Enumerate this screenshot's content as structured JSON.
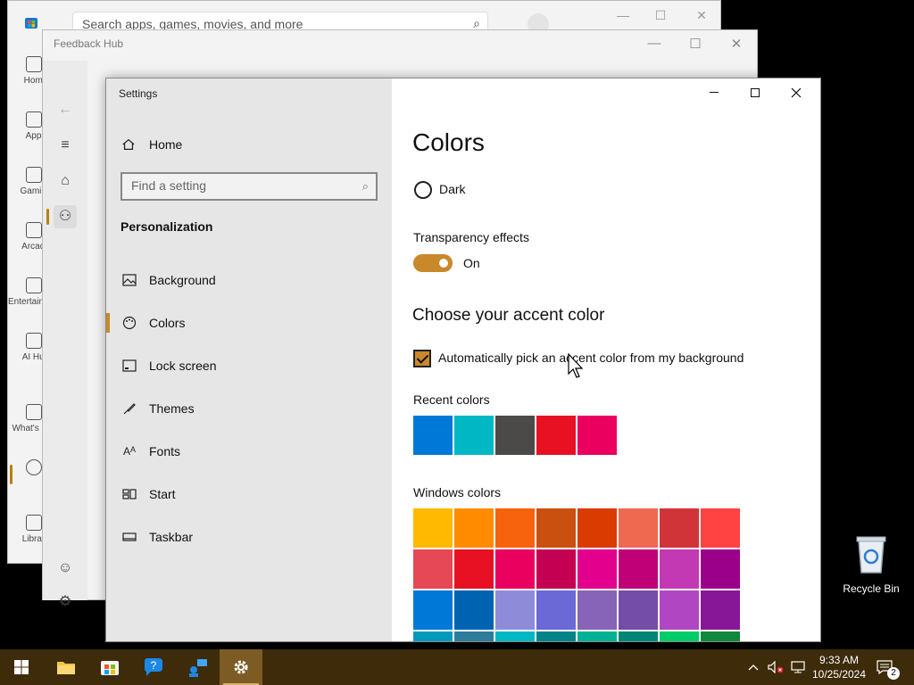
{
  "store": {
    "search_placeholder": "Search apps, games, movies, and more",
    "nav": [
      "Home",
      "Apps",
      "Gaming",
      "Arcade",
      "Entertainment",
      "AI Hub",
      "What's New",
      "",
      "Library"
    ]
  },
  "hub": {
    "title": "Feedback Hub"
  },
  "settings": {
    "app_title": "Settings",
    "home_label": "Home",
    "search_placeholder": "Find a setting",
    "section": "Personalization",
    "menu": [
      {
        "label": "Background",
        "icon": "picture-icon"
      },
      {
        "label": "Colors",
        "icon": "palette-icon"
      },
      {
        "label": "Lock screen",
        "icon": "lock-screen-icon"
      },
      {
        "label": "Themes",
        "icon": "themes-icon"
      },
      {
        "label": "Fonts",
        "icon": "fonts-icon"
      },
      {
        "label": "Start",
        "icon": "start-icon"
      },
      {
        "label": "Taskbar",
        "icon": "taskbar-icon"
      }
    ],
    "page_title": "Colors",
    "dark_option": "Dark",
    "transparency_label": "Transparency effects",
    "transparency_state": "On",
    "accent_heading": "Choose your accent color",
    "auto_pick_label": "Automatically pick an accent color from my background",
    "auto_pick_checked": true,
    "recent_label": "Recent colors",
    "windows_label": "Windows colors",
    "accent": "#c9882a",
    "recent_colors": [
      "#0078d7",
      "#00b7c3",
      "#4c4a48",
      "#e81123",
      "#ea005e"
    ],
    "windows_colors": [
      "#ffb900",
      "#ff8c00",
      "#f7630c",
      "#ca5010",
      "#da3b01",
      "#ef6950",
      "#d13438",
      "#ff4343",
      "#e74856",
      "#e81123",
      "#ea005e",
      "#c30052",
      "#e3008c",
      "#bf0077",
      "#c239b3",
      "#9a0089",
      "#0078d7",
      "#0063b1",
      "#8e8cd8",
      "#6b69d6",
      "#8764b8",
      "#744da9",
      "#b146c2",
      "#881798",
      "#0099bc",
      "#2d7d9a",
      "#00b7c3",
      "#038387",
      "#00b294",
      "#018574",
      "#00cc6a",
      "#10893e"
    ]
  },
  "desktop": {
    "recycle_bin": "Recycle Bin"
  },
  "taskbar": {
    "time": "9:33 AM",
    "date": "10/25/2024",
    "notifications": "2",
    "color": "#3d2b0a"
  }
}
